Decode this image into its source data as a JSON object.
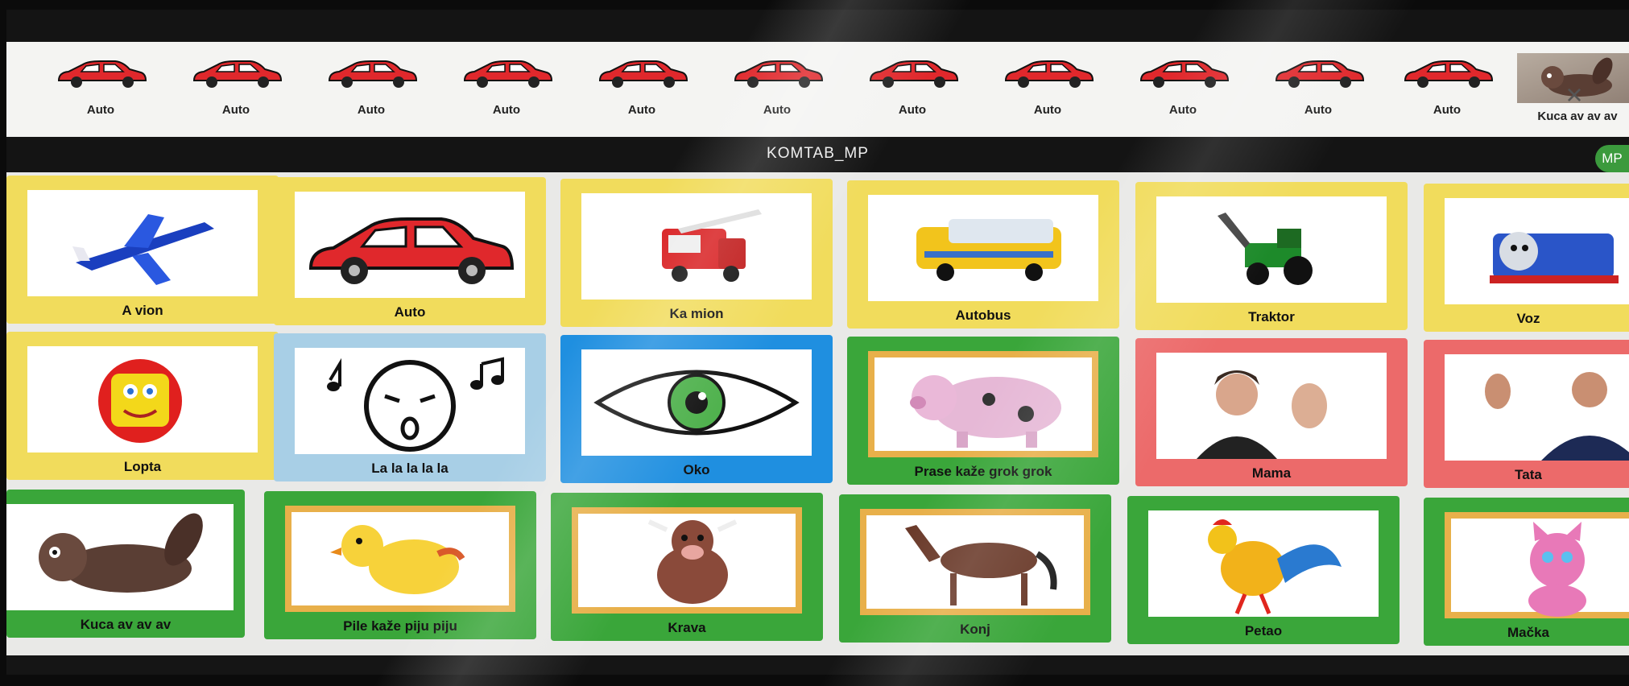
{
  "strip": {
    "items": [
      {
        "label": "Auto",
        "icon": "car-icon"
      },
      {
        "label": "Auto",
        "icon": "car-icon"
      },
      {
        "label": "Auto",
        "icon": "car-icon"
      },
      {
        "label": "Auto",
        "icon": "car-icon"
      },
      {
        "label": "Auto",
        "icon": "car-icon"
      },
      {
        "label": "Auto",
        "icon": "car-icon"
      },
      {
        "label": "Auto",
        "icon": "car-icon"
      },
      {
        "label": "Auto",
        "icon": "car-icon"
      },
      {
        "label": "Auto",
        "icon": "car-icon"
      },
      {
        "label": "Auto",
        "icon": "car-icon"
      },
      {
        "label": "Auto",
        "icon": "car-icon"
      },
      {
        "label": "Kuca av av av",
        "icon": "dog-photo"
      }
    ],
    "close_symbol": "×"
  },
  "header": {
    "title": "KOMTAB_MP",
    "user_initials": "MP"
  },
  "grid": {
    "rows": [
      [
        {
          "label": "A vion",
          "color": "#f1dc5c"
        },
        {
          "label": "Auto",
          "color": "#f1dc5c"
        },
        {
          "label": "Ka mion",
          "color": "#f1dc5c"
        },
        {
          "label": "Autobus",
          "color": "#f1dc5c"
        },
        {
          "label": "Traktor",
          "color": "#f1dc5c"
        },
        {
          "label": "Voz",
          "color": "#f1dc5c"
        }
      ],
      [
        {
          "label": "Lopta",
          "color": "#f1dc5c"
        },
        {
          "label": "La la la la la",
          "color": "#a8cfe6"
        },
        {
          "label": "Oko",
          "color": "#1f8fe0"
        },
        {
          "label": "Prase kaže grok grok",
          "color": "#3aa63a"
        },
        {
          "label": "Mama",
          "color": "#ec6a6a"
        },
        {
          "label": "Tata",
          "color": "#ec6a6a"
        }
      ],
      [
        {
          "label": "Kuca av av av",
          "color": "#3aa63a"
        },
        {
          "label": "Pile kaže piju piju",
          "color": "#3aa63a"
        },
        {
          "label": "Krava",
          "color": "#3aa63a"
        },
        {
          "label": "Konj",
          "color": "#3aa63a"
        },
        {
          "label": "Petao",
          "color": "#3aa63a"
        },
        {
          "label": "Mačka",
          "color": "#3aa63a"
        }
      ]
    ]
  }
}
